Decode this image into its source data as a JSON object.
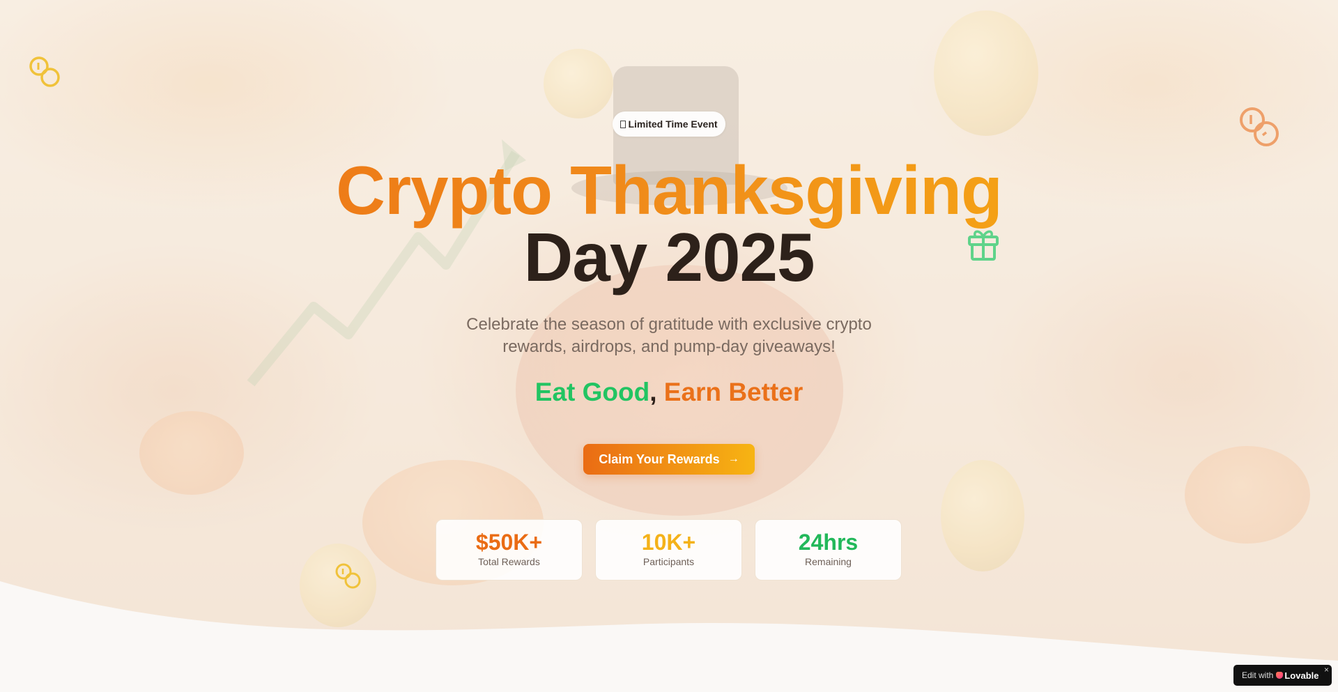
{
  "badge": {
    "icon": "calendar-icon",
    "label": "Limited Time Event"
  },
  "hero": {
    "title_line1": "Crypto Thanksgiving",
    "title_line2": "Day 2025",
    "subtitle": "Celebrate the season of gratitude with exclusive crypto rewards, airdrops, and pump-day giveaways!",
    "tagline_part1": "Eat Good",
    "tagline_separator": ",",
    "tagline_part2": "Earn Better",
    "cta_label": "Claim Your Rewards",
    "cta_icon": "arrow-right-icon"
  },
  "stats": [
    {
      "value": "$50K+",
      "label": "Total Rewards",
      "color": "#ea6c14"
    },
    {
      "value": "10K+",
      "label": "Participants",
      "color": "#f4b21a"
    },
    {
      "value": "24hrs",
      "label": "Remaining",
      "color": "#22b85a"
    }
  ],
  "decorations": {
    "icons": [
      "coins-icon",
      "coins-icon",
      "gift-icon",
      "coins-icon"
    ]
  },
  "lovable_badge": {
    "prefix": "Edit with",
    "brand": "Lovable",
    "close": "×"
  },
  "colors": {
    "accent_orange": "#ea6c14",
    "accent_yellow": "#f7b413",
    "accent_green": "#22c462",
    "dark_text": "#2d211a"
  }
}
